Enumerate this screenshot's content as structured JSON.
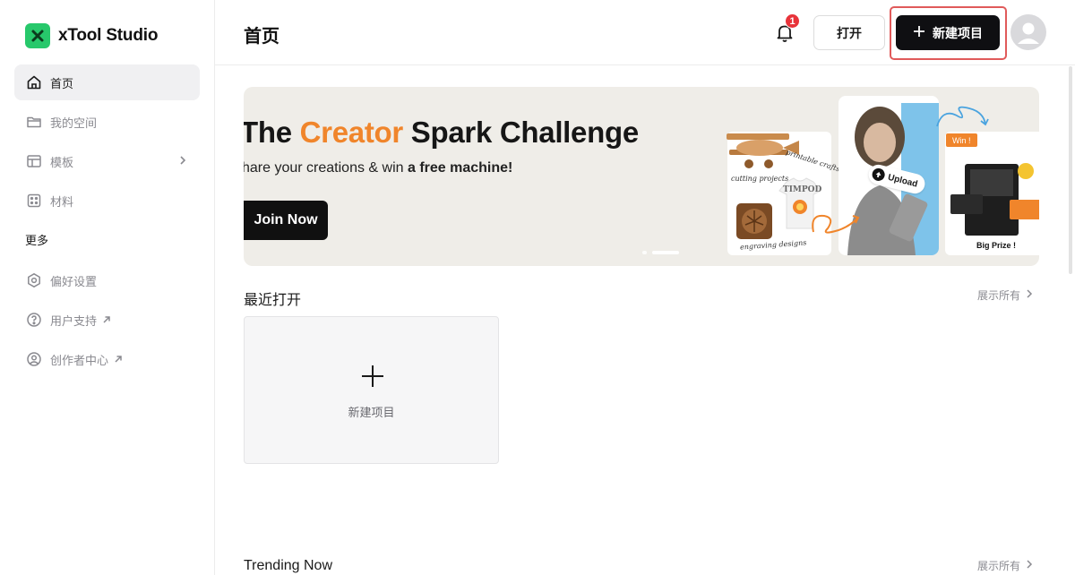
{
  "app": {
    "name": "xTool Studio",
    "brand_color": "#27c86b"
  },
  "sidebar": {
    "items": [
      {
        "label": "首页",
        "icon": "home-icon",
        "active": true
      },
      {
        "label": "我的空间",
        "icon": "folder-icon"
      },
      {
        "label": "模板",
        "icon": "template-icon",
        "has_submenu": true
      },
      {
        "label": "材料",
        "icon": "grid-icon"
      }
    ],
    "section_more": "更多",
    "more_items": [
      {
        "label": "偏好设置",
        "icon": "settings-icon"
      },
      {
        "label": "用户支持",
        "icon": "help-icon",
        "external": true
      },
      {
        "label": "创作者中心",
        "icon": "user-circle-icon",
        "external": true
      }
    ]
  },
  "header": {
    "title": "首页",
    "notification_count": "1",
    "open_label": "打开",
    "new_project_label": "新建项目"
  },
  "banner": {
    "title_pre": "The ",
    "title_accent": "Creator",
    "title_post": " Spark Challenge",
    "subtitle_pre": "hare your creations & win ",
    "subtitle_bold": "a free machine!",
    "cta": "Join Now",
    "accent_color": "#f0852b",
    "card_labels": {
      "printable": "printable crafts",
      "cutting": "cutting projects",
      "engraving": "engraving designs",
      "upload": "Upload",
      "win": "Win !",
      "prize": "Big Prize !",
      "shirt": "TIMPOD"
    },
    "slide_count": 2,
    "active_slide": 2
  },
  "recent": {
    "title": "最近打开",
    "show_all": "展示所有",
    "new_card_label": "新建项目"
  },
  "trending": {
    "title": "Trending Now",
    "show_all": "展示所有"
  }
}
